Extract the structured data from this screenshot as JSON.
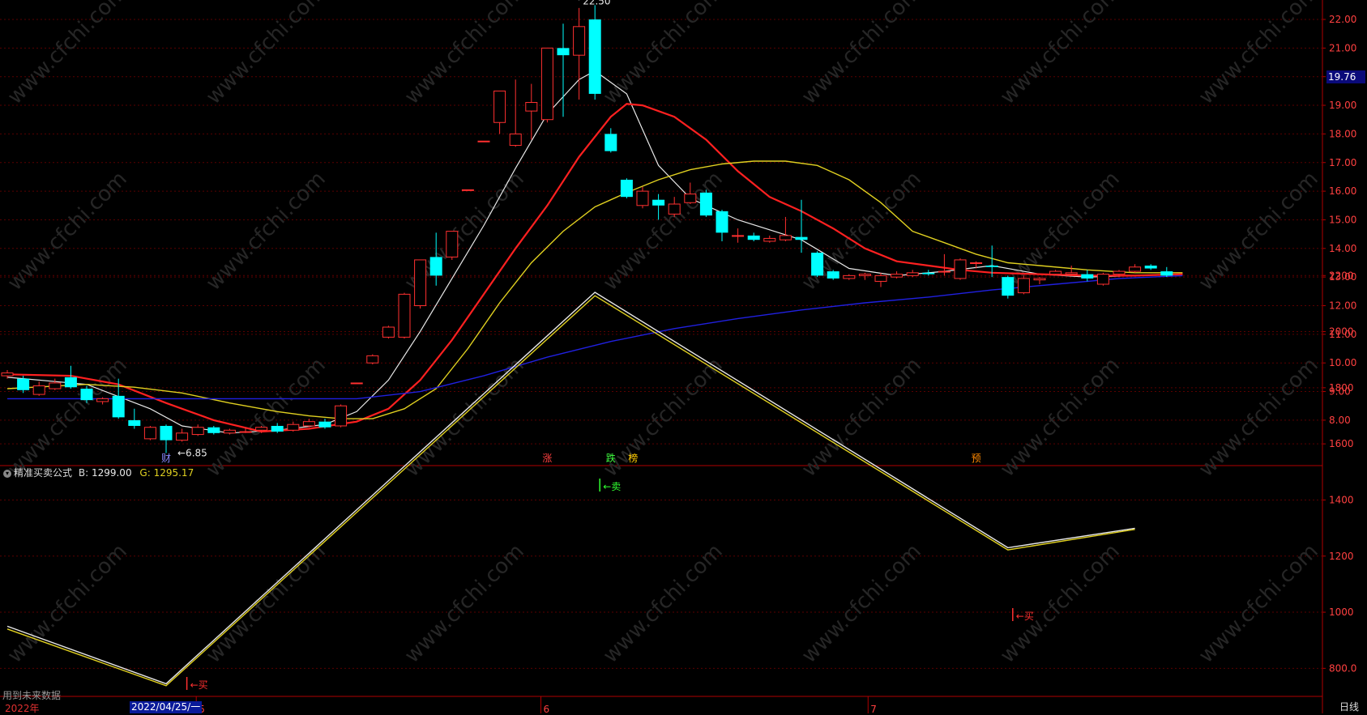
{
  "colors": {
    "up": "#ff3030",
    "down": "#00ffff",
    "ma5": "#e8e8e8",
    "ma10": "#ff2020",
    "ma20": "#e0d020",
    "ma60": "#2020e0",
    "axis": "#b00000",
    "tick_text": "#ff4040",
    "line_b": "#e8e8e8",
    "line_g": "#e0d020"
  },
  "labels": {
    "indicator_name": "精准买卖公式",
    "b_label": "B:",
    "b_value": "1299.00",
    "g_label": "G:",
    "g_value": "1295.17",
    "price_badge": "19.76",
    "period": "日线",
    "future_note": "用到未来数据",
    "date_badge": "2022/04/25/一",
    "year": "2022年"
  },
  "chart_data": [
    {
      "type": "candlestick",
      "panel": "price",
      "ylim": [
        7.0,
        22.4
      ],
      "y_ticks": [
        "8.00",
        "9.00",
        "10.00",
        "11.00",
        "12.00",
        "13.00",
        "14.00",
        "15.00",
        "16.00",
        "17.00",
        "18.00",
        "19.00",
        "20.00",
        "21.00",
        "22.00"
      ],
      "candles": [
        {
          "o": 9.55,
          "c": 9.65,
          "h": 9.75,
          "l": 9.45
        },
        {
          "o": 9.45,
          "c": 9.05,
          "h": 9.55,
          "l": 8.95
        },
        {
          "o": 8.9,
          "c": 9.2,
          "h": 9.35,
          "l": 8.85
        },
        {
          "o": 9.1,
          "c": 9.3,
          "h": 9.45,
          "l": 9.05
        },
        {
          "o": 9.5,
          "c": 9.15,
          "h": 9.9,
          "l": 9.1
        },
        {
          "o": 9.1,
          "c": 8.7,
          "h": 9.2,
          "l": 8.6
        },
        {
          "o": 8.65,
          "c": 8.75,
          "h": 8.8,
          "l": 8.55
        },
        {
          "o": 8.85,
          "c": 8.1,
          "h": 9.45,
          "l": 8.05
        },
        {
          "o": 8.0,
          "c": 7.8,
          "h": 8.4,
          "l": 7.7
        },
        {
          "o": 7.35,
          "c": 7.75,
          "h": 7.8,
          "l": 7.3
        },
        {
          "o": 7.8,
          "c": 7.3,
          "h": 7.85,
          "l": 6.85
        },
        {
          "o": 7.3,
          "c": 7.55,
          "h": 7.7,
          "l": 7.25
        },
        {
          "o": 7.5,
          "c": 7.75,
          "h": 7.85,
          "l": 7.45
        },
        {
          "o": 7.75,
          "c": 7.55,
          "h": 7.8,
          "l": 7.5
        },
        {
          "o": 7.55,
          "c": 7.65,
          "h": 7.7,
          "l": 7.5
        },
        {
          "o": 7.6,
          "c": 7.6,
          "h": 7.75,
          "l": 7.55
        },
        {
          "o": 7.65,
          "c": 7.75,
          "h": 7.8,
          "l": 7.55
        },
        {
          "o": 7.8,
          "c": 7.6,
          "h": 7.9,
          "l": 7.55
        },
        {
          "o": 7.65,
          "c": 7.85,
          "h": 7.95,
          "l": 7.6
        },
        {
          "o": 7.8,
          "c": 7.95,
          "h": 8.05,
          "l": 7.75
        },
        {
          "o": 7.95,
          "c": 7.75,
          "h": 8.05,
          "l": 7.7
        },
        {
          "o": 7.8,
          "c": 8.5,
          "h": 8.55,
          "l": 7.75
        },
        {
          "o": 9.3,
          "c": 9.3,
          "h": 9.3,
          "l": 9.3
        },
        {
          "o": 10.0,
          "c": 10.25,
          "h": 10.3,
          "l": 9.95
        },
        {
          "o": 10.9,
          "c": 11.25,
          "h": 11.3,
          "l": 10.85
        },
        {
          "o": 10.9,
          "c": 12.4,
          "h": 12.45,
          "l": 10.85
        },
        {
          "o": 12.0,
          "c": 13.6,
          "h": 13.6,
          "l": 11.9
        },
        {
          "o": 13.7,
          "c": 13.05,
          "h": 14.55,
          "l": 12.7
        },
        {
          "o": 13.7,
          "c": 14.6,
          "h": 14.6,
          "l": 13.6
        },
        {
          "o": 16.05,
          "c": 16.05,
          "h": 16.05,
          "l": 16.05
        },
        {
          "o": 17.75,
          "c": 17.75,
          "h": 17.75,
          "l": 17.75
        },
        {
          "o": 18.4,
          "c": 19.5,
          "h": 19.5,
          "l": 18.0
        },
        {
          "o": 17.6,
          "c": 18.0,
          "h": 19.9,
          "l": 17.55
        },
        {
          "o": 18.8,
          "c": 19.1,
          "h": 19.75,
          "l": 17.8
        },
        {
          "o": 18.5,
          "c": 21.0,
          "h": 21.0,
          "l": 18.4
        },
        {
          "o": 21.0,
          "c": 20.75,
          "h": 21.85,
          "l": 18.6
        },
        {
          "o": 20.75,
          "c": 21.75,
          "h": 22.4,
          "l": 19.2
        },
        {
          "o": 22.0,
          "c": 19.4,
          "h": 22.5,
          "l": 19.2
        },
        {
          "o": 18.0,
          "c": 17.4,
          "h": 18.2,
          "l": 17.35
        },
        {
          "o": 16.4,
          "c": 15.8,
          "h": 16.45,
          "l": 15.75
        },
        {
          "o": 15.5,
          "c": 16.0,
          "h": 16.15,
          "l": 15.4
        },
        {
          "o": 15.7,
          "c": 15.5,
          "h": 15.9,
          "l": 15.0
        },
        {
          "o": 15.2,
          "c": 15.55,
          "h": 15.8,
          "l": 15.1
        },
        {
          "o": 15.6,
          "c": 15.9,
          "h": 16.3,
          "l": 15.55
        },
        {
          "o": 15.95,
          "c": 15.15,
          "h": 16.05,
          "l": 15.1
        },
        {
          "o": 15.3,
          "c": 14.55,
          "h": 15.35,
          "l": 14.25
        },
        {
          "o": 14.45,
          "c": 14.45,
          "h": 14.7,
          "l": 14.2
        },
        {
          "o": 14.45,
          "c": 14.3,
          "h": 14.55,
          "l": 14.25
        },
        {
          "o": 14.25,
          "c": 14.35,
          "h": 14.45,
          "l": 14.2
        },
        {
          "o": 14.3,
          "c": 14.45,
          "h": 15.1,
          "l": 14.25
        },
        {
          "o": 14.4,
          "c": 14.3,
          "h": 15.7,
          "l": 13.85
        },
        {
          "o": 13.85,
          "c": 13.05,
          "h": 13.9,
          "l": 13.0
        },
        {
          "o": 13.2,
          "c": 12.95,
          "h": 13.25,
          "l": 12.9
        },
        {
          "o": 12.95,
          "c": 13.05,
          "h": 13.1,
          "l": 12.9
        },
        {
          "o": 13.05,
          "c": 13.1,
          "h": 13.15,
          "l": 12.9
        },
        {
          "o": 12.85,
          "c": 13.05,
          "h": 13.15,
          "l": 12.65
        },
        {
          "o": 13.0,
          "c": 13.1,
          "h": 13.2,
          "l": 12.95
        },
        {
          "o": 13.05,
          "c": 13.15,
          "h": 13.25,
          "l": 13.0
        },
        {
          "o": 13.15,
          "c": 13.1,
          "h": 13.25,
          "l": 13.05
        },
        {
          "o": 13.2,
          "c": 13.2,
          "h": 13.8,
          "l": 13.05
        },
        {
          "o": 12.95,
          "c": 13.6,
          "h": 13.65,
          "l": 12.9
        },
        {
          "o": 13.5,
          "c": 13.5,
          "h": 13.55,
          "l": 13.3
        },
        {
          "o": 13.4,
          "c": 13.35,
          "h": 14.1,
          "l": 13.0
        },
        {
          "o": 13.0,
          "c": 12.35,
          "h": 13.05,
          "l": 12.25
        },
        {
          "o": 12.45,
          "c": 12.95,
          "h": 13.05,
          "l": 12.4
        },
        {
          "o": 12.9,
          "c": 12.95,
          "h": 13.0,
          "l": 12.75
        },
        {
          "o": 13.1,
          "c": 13.2,
          "h": 13.25,
          "l": 13.05
        },
        {
          "o": 13.1,
          "c": 13.15,
          "h": 13.4,
          "l": 13.05
        },
        {
          "o": 13.1,
          "c": 12.95,
          "h": 13.25,
          "l": 12.85
        },
        {
          "o": 12.75,
          "c": 13.1,
          "h": 13.15,
          "l": 12.7
        },
        {
          "o": 13.1,
          "c": 13.2,
          "h": 13.25,
          "l": 13.0
        },
        {
          "o": 13.2,
          "c": 13.35,
          "h": 13.45,
          "l": 13.15
        },
        {
          "o": 13.4,
          "c": 13.3,
          "h": 13.45,
          "l": 13.25
        },
        {
          "o": 13.2,
          "c": 13.05,
          "h": 13.35,
          "l": 13.0
        }
      ],
      "ma": [
        {
          "name": "MA5",
          "points": [
            [
              0,
              9.5
            ],
            [
              5,
              9.25
            ],
            [
              9,
              8.4
            ],
            [
              11,
              7.8
            ],
            [
              14,
              7.55
            ],
            [
              17,
              7.65
            ],
            [
              20,
              7.85
            ],
            [
              22,
              8.3
            ],
            [
              24,
              9.4
            ],
            [
              26,
              11.1
            ],
            [
              28,
              12.95
            ],
            [
              30,
              14.8
            ],
            [
              32,
              16.8
            ],
            [
              34,
              18.7
            ],
            [
              36,
              19.9
            ],
            [
              37,
              20.2
            ],
            [
              39,
              19.4
            ],
            [
              41,
              16.9
            ],
            [
              43,
              15.75
            ],
            [
              46,
              15.0
            ],
            [
              50,
              14.3
            ],
            [
              53,
              13.3
            ],
            [
              56,
              13.05
            ],
            [
              59,
              13.2
            ],
            [
              62,
              13.4
            ],
            [
              65,
              13.1
            ],
            [
              68,
              13.0
            ],
            [
              71,
              13.05
            ],
            [
              74,
              13.1
            ]
          ]
        },
        {
          "name": "MA10",
          "points": [
            [
              0,
              9.6
            ],
            [
              4,
              9.55
            ],
            [
              7,
              9.25
            ],
            [
              10,
              8.6
            ],
            [
              13,
              8.0
            ],
            [
              16,
              7.6
            ],
            [
              19,
              7.7
            ],
            [
              22,
              7.95
            ],
            [
              24,
              8.4
            ],
            [
              26,
              9.4
            ],
            [
              28,
              10.8
            ],
            [
              30,
              12.4
            ],
            [
              32,
              14.0
            ],
            [
              34,
              15.5
            ],
            [
              36,
              17.2
            ],
            [
              38,
              18.6
            ],
            [
              39,
              19.05
            ],
            [
              40,
              19.0
            ],
            [
              42,
              18.6
            ],
            [
              44,
              17.8
            ],
            [
              46,
              16.7
            ],
            [
              48,
              15.8
            ],
            [
              50,
              15.3
            ],
            [
              52,
              14.7
            ],
            [
              54,
              14.0
            ],
            [
              56,
              13.55
            ],
            [
              58,
              13.4
            ],
            [
              60,
              13.25
            ],
            [
              62,
              13.15
            ],
            [
              65,
              13.1
            ],
            [
              68,
              13.05
            ],
            [
              71,
              13.05
            ],
            [
              74,
              13.1
            ]
          ]
        },
        {
          "name": "MA20",
          "points": [
            [
              0,
              9.1
            ],
            [
              5,
              9.25
            ],
            [
              8,
              9.15
            ],
            [
              11,
              8.95
            ],
            [
              14,
              8.6
            ],
            [
              17,
              8.3
            ],
            [
              19,
              8.15
            ],
            [
              21,
              8.05
            ],
            [
              23,
              8.05
            ],
            [
              25,
              8.4
            ],
            [
              27,
              9.1
            ],
            [
              29,
              10.5
            ],
            [
              31,
              12.1
            ],
            [
              33,
              13.5
            ],
            [
              35,
              14.6
            ],
            [
              37,
              15.45
            ],
            [
              39,
              15.95
            ],
            [
              41,
              16.4
            ],
            [
              43,
              16.75
            ],
            [
              45,
              16.95
            ],
            [
              47,
              17.05
            ],
            [
              49,
              17.05
            ],
            [
              51,
              16.9
            ],
            [
              53,
              16.4
            ],
            [
              55,
              15.6
            ],
            [
              57,
              14.6
            ],
            [
              59,
              14.2
            ],
            [
              61,
              13.8
            ],
            [
              63,
              13.5
            ],
            [
              65,
              13.4
            ],
            [
              68,
              13.25
            ],
            [
              71,
              13.15
            ],
            [
              74,
              13.15
            ]
          ]
        },
        {
          "name": "MA60",
          "points": [
            [
              0,
              8.75
            ],
            [
              22,
              8.75
            ],
            [
              26,
              9.0
            ],
            [
              30,
              9.55
            ],
            [
              34,
              10.2
            ],
            [
              38,
              10.75
            ],
            [
              42,
              11.2
            ],
            [
              46,
              11.55
            ],
            [
              50,
              11.85
            ],
            [
              54,
              12.1
            ],
            [
              58,
              12.3
            ],
            [
              62,
              12.55
            ],
            [
              66,
              12.75
            ],
            [
              70,
              12.95
            ],
            [
              74,
              13.05
            ]
          ]
        }
      ],
      "annotations": [
        {
          "text": "22.50",
          "kind": "high",
          "value": 22.5
        },
        {
          "text": "6.85",
          "kind": "low",
          "value": 6.85
        }
      ],
      "event_markers": [
        "财",
        "涨",
        "跌",
        "榜",
        "预"
      ]
    },
    {
      "type": "line",
      "panel": "indicator",
      "ylim": [
        700,
        2300
      ],
      "y_ticks": [
        "800.0",
        "1000",
        "1200",
        "1400",
        "1600",
        "1800",
        "2000",
        "2200"
      ],
      "x_tick_labels": [
        "5",
        "6",
        "7"
      ],
      "series": [
        {
          "name": "B",
          "points": [
            [
              0,
              950
            ],
            [
              10,
              745
            ],
            [
              37,
              2140
            ],
            [
              63,
              1230
            ],
            [
              71,
              1299
            ]
          ]
        },
        {
          "name": "G",
          "points": [
            [
              0,
              940
            ],
            [
              10,
              738
            ],
            [
              37,
              2128
            ],
            [
              63,
              1222
            ],
            [
              71,
              1295
            ]
          ]
        }
      ],
      "signals": [
        {
          "text": "←买",
          "index": 11
        },
        {
          "text": "←卖",
          "index": 37
        },
        {
          "text": "←买",
          "index": 63
        }
      ]
    }
  ]
}
